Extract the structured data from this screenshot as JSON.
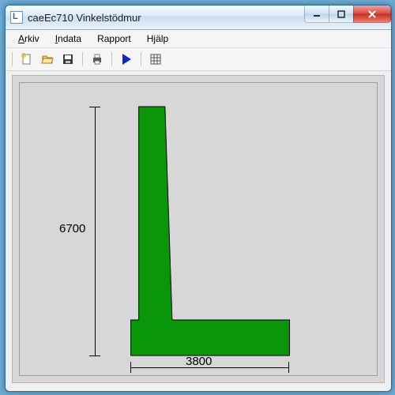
{
  "window": {
    "title": "caeEc710 Vinkelstödmur"
  },
  "menubar": {
    "arkiv": "Arkiv",
    "arkiv_accel": "A",
    "indata": "Indata",
    "indata_accel": "I",
    "rapport": "Rapport",
    "hjalp": "Hjälp"
  },
  "toolbar": {
    "new": "new-icon",
    "open": "open-icon",
    "save": "save-icon",
    "print": "print-icon",
    "run": "run-icon",
    "grid": "grid-icon"
  },
  "dimensions": {
    "height": "6700",
    "width": "3800"
  }
}
